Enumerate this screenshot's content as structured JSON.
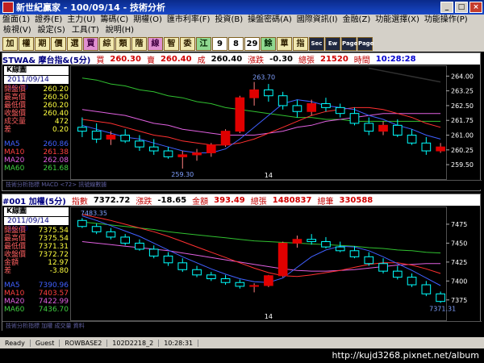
{
  "window": {
    "title": "新世紀贏家 - 100/09/14 - 技術分析"
  },
  "menu": {
    "row1": [
      "盤面(1)",
      "證券(E)",
      "主力(U)",
      "籌碼(C)",
      "期權(O)",
      "匯市利率(F)",
      "投資(B)",
      "操盤密碼(A)",
      "國際資訊(I)",
      "金融(Z)",
      "功能選擇(X)",
      "功能操作(P)"
    ],
    "row2": [
      "檢視(V)",
      "設定(S)",
      "工具(T)",
      "說明(H)"
    ]
  },
  "toolbar": {
    "buttons": [
      "加",
      "權",
      "期",
      "價",
      "選",
      "買",
      "綜",
      "類",
      "階",
      "線",
      "智",
      "委",
      "江",
      "9",
      "8",
      "29",
      "餘",
      "單",
      "指"
    ],
    "small_buttons": [
      "Sec",
      "Ew",
      "Page",
      "Page"
    ]
  },
  "colors": {
    "up": "#e00000",
    "down": "#00ffff",
    "ma5": "#4060ff",
    "ma10": "#ff3030",
    "ma20": "#e060e0",
    "ma60": "#30c030",
    "aux": "#202020"
  },
  "panels": [
    {
      "header": {
        "symbol": "STWA& 摩台指&(5分)",
        "buy_label": "買",
        "buy": "260.30",
        "sell_label": "賣",
        "sell": "260.40",
        "deal_label": "成",
        "deal": "260.40",
        "change_label": "漲跌",
        "change": "-0.30",
        "volume_label": "總張",
        "volume": "21520",
        "time_label": "時間",
        "time": "10:28:28"
      },
      "info": {
        "title": "K線圖",
        "date": "2011/09/14 10:30",
        "fields": [
          {
            "label": "開盤價",
            "value": "260.20"
          },
          {
            "label": "最高價",
            "value": "260.50"
          },
          {
            "label": "最低價",
            "value": "260.20"
          },
          {
            "label": "收盤價",
            "value": "260.40"
          },
          {
            "label": "成交量",
            "value": "472"
          },
          {
            "label": "差",
            "value": "0.20"
          }
        ],
        "ma": [
          {
            "label": "MA5",
            "value": "260.86"
          },
          {
            "label": "MA10",
            "value": "261.38"
          },
          {
            "label": "MA20",
            "value": "262.08"
          },
          {
            "label": "MA60",
            "value": "261.68"
          }
        ]
      },
      "chart_data": {
        "type": "candlestick",
        "ylim": [
          259.3,
          264.3
        ],
        "yticks": [
          "264.00",
          "263.25",
          "262.50",
          "261.75",
          "261.00",
          "260.25",
          "259.50"
        ],
        "ytick_values": [
          264.0,
          263.25,
          262.5,
          261.75,
          261.0,
          260.25,
          259.5
        ],
        "xlabel_mid": "14",
        "high_label": "263.70",
        "low_label": "259.30",
        "high_value": 263.7,
        "low_value": 259.3,
        "high_index": 12,
        "low_index": 7,
        "candles": [
          [
            261.4,
            261.9,
            260.9,
            261.2
          ],
          [
            261.2,
            261.6,
            260.6,
            260.8
          ],
          [
            260.8,
            261.2,
            260.5,
            261.0
          ],
          [
            261.0,
            261.3,
            260.6,
            260.7
          ],
          [
            260.7,
            261.0,
            260.2,
            260.4
          ],
          [
            260.4,
            260.8,
            260.0,
            260.2
          ],
          [
            260.2,
            260.4,
            259.8,
            259.9
          ],
          [
            259.9,
            260.2,
            259.3,
            260.0
          ],
          [
            260.0,
            260.3,
            259.7,
            260.1
          ],
          [
            260.1,
            260.6,
            259.9,
            260.5
          ],
          [
            260.5,
            261.3,
            260.4,
            261.2
          ],
          [
            261.2,
            263.0,
            261.1,
            262.9
          ],
          [
            262.9,
            263.7,
            262.5,
            263.3
          ],
          [
            263.3,
            263.6,
            262.7,
            263.0
          ],
          [
            263.0,
            263.2,
            262.3,
            262.5
          ],
          [
            262.5,
            262.8,
            261.9,
            262.2
          ],
          [
            262.2,
            262.8,
            262.0,
            262.6
          ],
          [
            262.6,
            262.9,
            262.2,
            262.4
          ],
          [
            262.4,
            262.6,
            261.9,
            262.1
          ],
          [
            262.1,
            262.4,
            261.5,
            261.6
          ],
          [
            261.6,
            261.9,
            261.0,
            261.2
          ],
          [
            261.2,
            261.7,
            261.0,
            261.5
          ],
          [
            261.5,
            261.8,
            260.9,
            261.0
          ],
          [
            261.0,
            261.3,
            260.5,
            260.6
          ],
          [
            260.6,
            260.9,
            260.0,
            260.2
          ],
          [
            260.2,
            260.6,
            260.1,
            260.4
          ]
        ],
        "ma5": [
          261.5,
          261.3,
          261.1,
          260.9,
          260.8,
          260.6,
          260.4,
          260.2,
          260.1,
          260.1,
          260.3,
          260.8,
          261.4,
          262.0,
          262.6,
          262.8,
          262.7,
          262.5,
          262.4,
          262.3,
          262.0,
          261.8,
          261.5,
          261.3,
          261.0,
          260.8
        ],
        "ma10": [
          261.8,
          261.7,
          261.6,
          261.4,
          261.2,
          261.0,
          260.9,
          260.7,
          260.6,
          260.5,
          260.5,
          260.6,
          260.8,
          261.1,
          261.4,
          261.7,
          262.0,
          262.2,
          262.3,
          262.4,
          262.4,
          262.3,
          262.1,
          261.9,
          261.6,
          261.4
        ],
        "ma20": [
          262.3,
          262.2,
          262.1,
          262.0,
          261.8,
          261.6,
          261.5,
          261.3,
          261.2,
          261.1,
          261.0,
          261.0,
          261.0,
          261.1,
          261.2,
          261.4,
          261.5,
          261.7,
          261.8,
          261.9,
          262.0,
          262.1,
          262.1,
          262.1,
          262.1,
          262.1
        ],
        "ma60": [
          263.9,
          263.8,
          263.6,
          263.5,
          263.3,
          263.2,
          263.0,
          262.9,
          262.7,
          262.6,
          262.4,
          262.3,
          262.2,
          262.1,
          262.0,
          261.9,
          261.9,
          261.8,
          261.8,
          261.7,
          261.7,
          261.7,
          261.7,
          261.7,
          261.7,
          261.7
        ],
        "aux_line": [
          [
            20,
            264.4
          ],
          [
            25,
            263.7
          ]
        ]
      },
      "strip": "技術分析指標 MACD <72> 訊號線數據"
    },
    {
      "header": {
        "symbol": "#001 加權(5分)",
        "index_label": "指數",
        "index": "7372.72",
        "change_label": "漲跌",
        "change": "-18.65",
        "amount_label": "金額",
        "amount": "393.49",
        "vol_label": "總張",
        "vol": "1480837",
        "cnt_label": "總筆",
        "cnt": "330588"
      },
      "info": {
        "title": "K線圖",
        "date": "2011/09/14 10:30",
        "fields": [
          {
            "label": "開盤價",
            "value": "7375.54"
          },
          {
            "label": "最高價",
            "value": "7375.54"
          },
          {
            "label": "最低價",
            "value": "7371.31"
          },
          {
            "label": "收盤價",
            "value": "7372.72"
          },
          {
            "label": "金額",
            "value": "12.97"
          },
          {
            "label": "差",
            "value": "-3.80"
          }
        ],
        "ma": [
          {
            "label": "MA5",
            "value": "7390.96"
          },
          {
            "label": "MA10",
            "value": "7403.57"
          },
          {
            "label": "MA20",
            "value": "7422.99"
          },
          {
            "label": "MA60",
            "value": "7436.70"
          }
        ]
      },
      "chart_data": {
        "type": "candlestick",
        "ylim": [
          7362,
          7492
        ],
        "yticks": [
          "7475",
          "7450",
          "7425",
          "7400",
          "7375"
        ],
        "ytick_values": [
          7475,
          7450,
          7425,
          7400,
          7375
        ],
        "xlabel_mid": "14",
        "high_label": "7483.35",
        "low_label": "7371.31",
        "high_value": 7483.35,
        "low_value": 7371.31,
        "high_index": 0,
        "low_index": 25,
        "candles": [
          [
            7480,
            7483,
            7470,
            7472
          ],
          [
            7472,
            7476,
            7462,
            7465
          ],
          [
            7465,
            7470,
            7455,
            7458
          ],
          [
            7458,
            7462,
            7447,
            7450
          ],
          [
            7450,
            7455,
            7440,
            7442
          ],
          [
            7442,
            7447,
            7430,
            7433
          ],
          [
            7433,
            7438,
            7420,
            7424
          ],
          [
            7424,
            7430,
            7412,
            7415
          ],
          [
            7415,
            7420,
            7405,
            7408
          ],
          [
            7408,
            7412,
            7400,
            7403
          ],
          [
            7403,
            7408,
            7395,
            7398
          ],
          [
            7398,
            7402,
            7390,
            7393
          ],
          [
            7393,
            7397,
            7385,
            7394
          ],
          [
            7394,
            7408,
            7392,
            7407
          ],
          [
            7407,
            7452,
            7405,
            7450
          ],
          [
            7450,
            7460,
            7444,
            7455
          ],
          [
            7455,
            7462,
            7448,
            7452
          ],
          [
            7452,
            7458,
            7443,
            7445
          ],
          [
            7445,
            7452,
            7438,
            7440
          ],
          [
            7440,
            7446,
            7430,
            7432
          ],
          [
            7432,
            7438,
            7420,
            7423
          ],
          [
            7423,
            7430,
            7410,
            7413
          ],
          [
            7413,
            7420,
            7402,
            7405
          ],
          [
            7405,
            7410,
            7392,
            7395
          ],
          [
            7395,
            7400,
            7380,
            7383
          ],
          [
            7383,
            7386,
            7371,
            7373
          ]
        ],
        "ma5": [
          7486,
          7480,
          7473,
          7466,
          7459,
          7450,
          7441,
          7432,
          7424,
          7416,
          7409,
          7403,
          7399,
          7398,
          7404,
          7418,
          7432,
          7441,
          7446,
          7445,
          7440,
          7432,
          7423,
          7414,
          7404,
          7394
        ],
        "ma10": [
          7488,
          7484,
          7480,
          7475,
          7470,
          7465,
          7459,
          7452,
          7445,
          7438,
          7431,
          7424,
          7417,
          7411,
          7407,
          7406,
          7408,
          7411,
          7414,
          7418,
          7422,
          7424,
          7424,
          7421,
          7416,
          7410
        ],
        "ma20": [
          7452,
          7450,
          7448,
          7446,
          7444,
          7442,
          7440,
          7437,
          7434,
          7431,
          7428,
          7425,
          7422,
          7419,
          7416,
          7414,
          7413,
          7413,
          7414,
          7415,
          7417,
          7419,
          7421,
          7422,
          7423,
          7423
        ],
        "ma60": [
          7478,
          7476,
          7474,
          7472,
          7470,
          7468,
          7465,
          7463,
          7461,
          7459,
          7457,
          7455,
          7453,
          7452,
          7451,
          7450,
          7449,
          7448,
          7447,
          7446,
          7444,
          7443,
          7441,
          7440,
          7438,
          7437
        ]
      },
      "strip": "技術分析指標 加權 成交量 資料"
    }
  ],
  "statusbar": [
    "Ready",
    "Guest",
    "ROWBASE2",
    "102D2218_2",
    "10:28:31"
  ],
  "watermark": "http://kujd3268.pixnet.net/album"
}
